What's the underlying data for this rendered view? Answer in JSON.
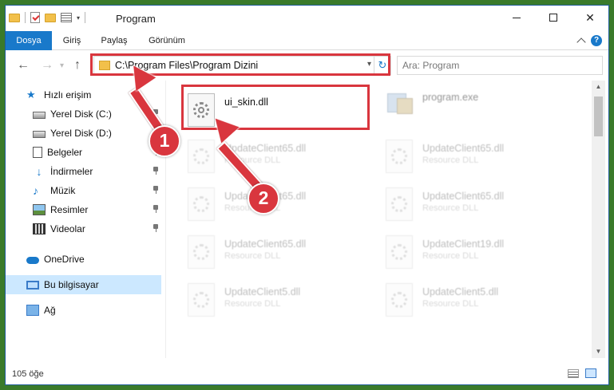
{
  "window": {
    "title": "Program"
  },
  "ribbon": {
    "tabs": [
      "Dosya",
      "Giriş",
      "Paylaş",
      "Görünüm"
    ],
    "help": "?"
  },
  "nav": {
    "back": "←",
    "forward": "→",
    "up": "↑"
  },
  "address": {
    "path": "C:\\Program Files\\Program Dizini",
    "refresh": "↻"
  },
  "search": {
    "placeholder": "Ara: Program"
  },
  "sidebar": {
    "quick_access": "Hızlı erişim",
    "items": [
      "Yerel Disk (C:)",
      "Yerel Disk (D:)",
      "Belgeler",
      "İndirmeler",
      "Müzik",
      "Resimler",
      "Videolar"
    ],
    "onedrive": "OneDrive",
    "this_pc": "Bu bilgisayar",
    "network": "Ağ"
  },
  "files": {
    "highlighted": {
      "name": "ui_skin.dll",
      "desc": ""
    },
    "exe": {
      "name": "program.exe"
    },
    "faded": [
      {
        "name": "UpdateClient65.dll",
        "desc": "Resource DLL"
      },
      {
        "name": "UpdateClient65.dll",
        "desc": "Resource DLL"
      },
      {
        "name": "UpdateClient65.dll",
        "desc": "Resource DLL"
      },
      {
        "name": "UpdateClient65.dll",
        "desc": "Resource DLL"
      },
      {
        "name": "UpdateClient65.dll",
        "desc": "Resource DLL"
      },
      {
        "name": "UpdateClient19.dll",
        "desc": "Resource DLL"
      },
      {
        "name": "UpdateClient5.dll",
        "desc": "Resource DLL"
      },
      {
        "name": "UpdateClient5.dll",
        "desc": "Resource DLL"
      }
    ]
  },
  "status": {
    "count": "105 öğe"
  },
  "annotations": {
    "step1": "1",
    "step2": "2"
  },
  "colors": {
    "accent": "#1979ca",
    "annotation": "#d9363e",
    "selection": "#cce8ff"
  }
}
